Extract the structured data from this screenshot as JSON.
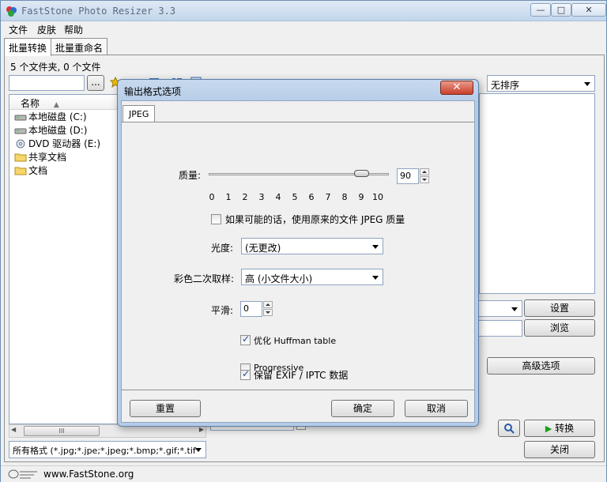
{
  "window": {
    "title": "FastStone Photo Resizer 3.3"
  },
  "menu": [
    "文件",
    "皮肤",
    "帮助"
  ],
  "tabs": [
    "批量转换",
    "批量重命名"
  ],
  "file_count": "5 个文件夹, 0 个文件",
  "browse_small": "...",
  "tree": {
    "column_header": "名称",
    "items": [
      {
        "label": "本地磁盘 (C:)",
        "icon": "drive-icon"
      },
      {
        "label": "本地磁盘 (D:)",
        "icon": "drive-icon"
      },
      {
        "label": "DVD 驱动器 (E:)",
        "icon": "dvd-icon"
      },
      {
        "label": "共享文档",
        "icon": "folder-icon"
      },
      {
        "label": "文档",
        "icon": "folder-icon"
      }
    ]
  },
  "scroll_grip": "III",
  "filter": "所有格式 (*.jpg;*.jpe;*.jpeg;*.bmp;*.gif;*.tif",
  "sort": {
    "value": "无排序"
  },
  "buttons": {
    "settings": "设置",
    "browse": "浏览",
    "advanced": "高级选项",
    "convert": "转换",
    "close": "关闭"
  },
  "status": {
    "url": "www.FastStone.org"
  },
  "dialog": {
    "title": "输出格式选项",
    "close": "✕",
    "tab": "JPEG",
    "quality_label": "质量:",
    "quality_value": "90",
    "quality_fraction": 0.9,
    "ticks": [
      "0",
      "1",
      "2",
      "3",
      "4",
      "5",
      "6",
      "7",
      "8",
      "9",
      "10"
    ],
    "use_original": "如果可能的话，使用原来的文件 JPEG 质量",
    "brightness_label": "光度:",
    "brightness_value": "(无更改)",
    "subsampling_label": "彩色二次取样:",
    "subsampling_value": "高 (小文件大小)",
    "smoothing_label": "平滑:",
    "smoothing_value": "0",
    "optimize_huffman": "优化 Huffman table",
    "progressive": "Progressive",
    "keep_exif": "保留 EXIF / IPTC 数据",
    "reset": "重置",
    "ok": "确定",
    "cancel": "取消"
  }
}
